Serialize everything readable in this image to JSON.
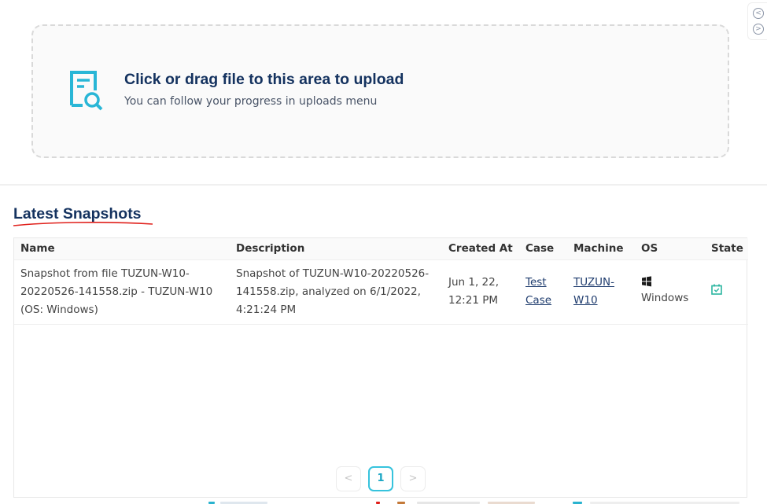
{
  "upload": {
    "title": "Click or drag file to this area to upload",
    "subtitle": "You can follow your progress in uploads menu",
    "icon": "file-search-icon",
    "accent_color": "#29b6d6"
  },
  "side_nav": {
    "prev_label": "<",
    "next_label": ">"
  },
  "section": {
    "title": "Latest Snapshots"
  },
  "table": {
    "columns": [
      "Name",
      "Description",
      "Created At",
      "Case",
      "Machine",
      "OS",
      "State"
    ],
    "rows": [
      {
        "name": "Snapshot from file TUZUN-W10-20220526-141558.zip - TUZUN-W10 (OS: Windows)",
        "description": "Snapshot of TUZUN-W10-20220526-141558.zip, analyzed on 6/1/2022, 4:21:24 PM",
        "created_at": "Jun 1, 22, 12:21 PM",
        "case": "Test Case",
        "machine": "TUZUN-W10",
        "os": "Windows",
        "os_icon": "windows-icon",
        "state_icon": "calendar-check-icon"
      }
    ]
  },
  "pagination": {
    "prev_label": "<",
    "current_page": "1",
    "next_label": ">"
  }
}
